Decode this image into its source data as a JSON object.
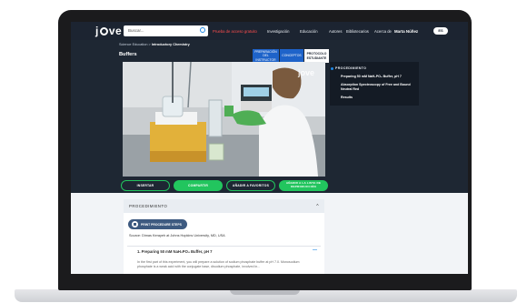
{
  "nav": {
    "logo": "jove",
    "search_placeholder": "Buscar...",
    "items": [
      "Investigación",
      "Educación",
      "Autores",
      "Bibliotecarios",
      "Acerca de"
    ],
    "red_link": "Prueba de acceso gratuito",
    "user": "Marta Núñez",
    "lang": "ES"
  },
  "breadcrumb": {
    "root": "Science Education",
    "sep": ">",
    "current": "Introductory Chemistry"
  },
  "page_title": "Buffers",
  "tabs": [
    "PREPARACIÓN DEL INSTRUCTOR",
    "CONCEPTOS",
    "PROTOCOLO ESTUDIANTE"
  ],
  "video": {
    "watermark": "jove"
  },
  "actions": [
    "INSERTAR",
    "COMPARTIR",
    "AÑADIR A FAVORITOS",
    "AÑADIR A LA LISTA DE REPRODUCCIÓN"
  ],
  "sidebar": {
    "heading": "PROCEDIMIENTO",
    "items": [
      "Preparing 50 mM NaH₂PO₄ Buffer, pH 7",
      "Absorption Spectroscopy of Free and Bound Neutral Red",
      "Results"
    ]
  },
  "procedure": {
    "heading": "PROCEDIMIENTO",
    "print_label": "PRINT PROCEDURE STEPS",
    "source": "Source: Dimas Kerayeh at Johns Hopkins University, MD, USA",
    "step_title": "1. Preparing 50 mM NaH₂PO₄ Buffer, pH 7",
    "step_text": "In the first part of this experiment, you will prepare a solution of sodium phosphate buffer at pH 7.0. Monosodium phosphate is a weak acid with the conjugate base, disodium phosphate, involved in..."
  },
  "colors": {
    "nav_bg": "#1c2431",
    "accent_green": "#22c55e",
    "accent_blue": "#1e63c9",
    "red": "#ff4d4d"
  }
}
